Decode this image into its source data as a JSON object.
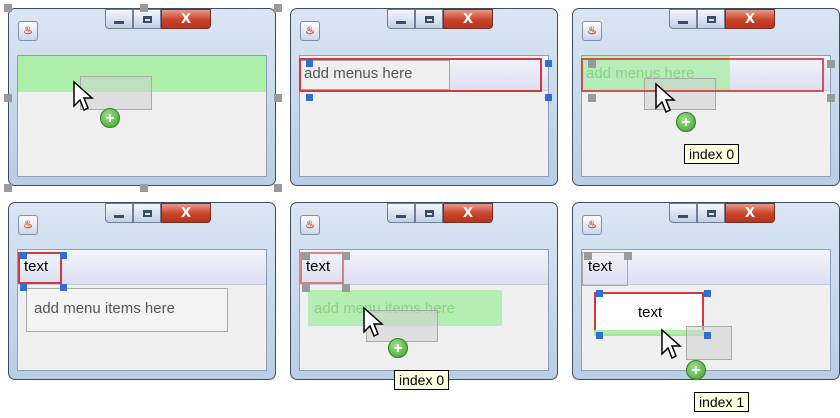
{
  "panels": [
    {
      "id": "p1",
      "labels": {}
    },
    {
      "id": "p2",
      "labels": {
        "placeholder": "add menus here"
      }
    },
    {
      "id": "p3",
      "labels": {
        "placeholder": "add menus here",
        "tooltip": "index 0"
      }
    },
    {
      "id": "p4",
      "labels": {
        "menu": "text",
        "items_placeholder": "add menu items here"
      }
    },
    {
      "id": "p5",
      "labels": {
        "menu": "text",
        "items_placeholder": "add menu items here",
        "tooltip": "index 0"
      }
    },
    {
      "id": "p6",
      "labels": {
        "menu": "text",
        "item": "text",
        "tooltip": "index 1"
      }
    }
  ],
  "window_buttons": {
    "close_glyph": "X"
  },
  "colors": {
    "selection": "#d13a3a",
    "handle": "#2f6fd1",
    "drop": "#a6eea3"
  }
}
